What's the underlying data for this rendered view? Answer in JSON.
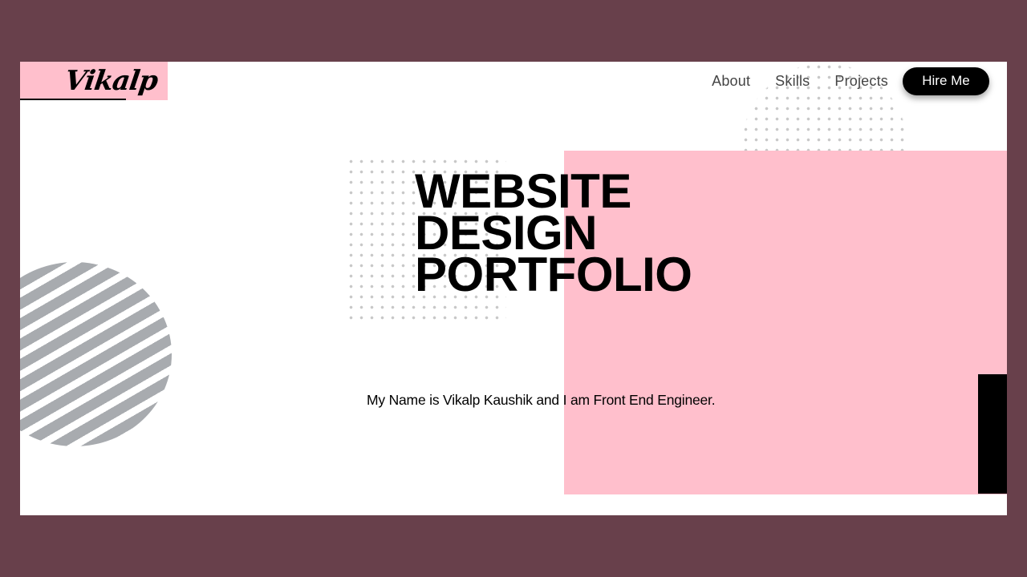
{
  "brand": {
    "logo_text": "Vikalp"
  },
  "nav": {
    "items": [
      {
        "label": "About"
      },
      {
        "label": "Skills"
      },
      {
        "label": "Projects"
      }
    ],
    "cta_label": "Hire Me"
  },
  "hero": {
    "headline_lines": [
      "WEBSITE",
      "DESIGN",
      "PORTFOLIO"
    ],
    "intro": "My Name is Vikalp Kaushik and I am Front End Engineer."
  },
  "colors": {
    "outer_background": "#68404b",
    "page_background": "#ffffff",
    "accent_pink": "#ffbfcc",
    "stripe_gray": "#a8abaf",
    "button_black": "#000000"
  }
}
